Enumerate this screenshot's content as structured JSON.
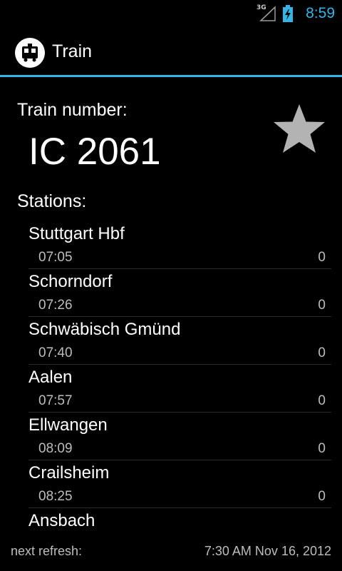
{
  "status_bar": {
    "network": "3G",
    "time": "8:59",
    "accent_color": "#33b5e5"
  },
  "action_bar": {
    "icon": "tram-icon",
    "title": "Train"
  },
  "train": {
    "label": "Train number:",
    "number": "IC 2061",
    "favorite_icon": "star-icon"
  },
  "stations": {
    "label": "Stations:",
    "items": [
      {
        "name": "Stuttgart Hbf",
        "time": "07:05",
        "delay": "0"
      },
      {
        "name": "Schorndorf",
        "time": "07:26",
        "delay": "0"
      },
      {
        "name": "Schwäbisch Gmünd",
        "time": "07:40",
        "delay": "0"
      },
      {
        "name": "Aalen",
        "time": "07:57",
        "delay": "0"
      },
      {
        "name": "Ellwangen",
        "time": "08:09",
        "delay": "0"
      },
      {
        "name": "Crailsheim",
        "time": "08:25",
        "delay": "0"
      },
      {
        "name": "Ansbach",
        "time": "",
        "delay": ""
      }
    ]
  },
  "footer": {
    "label": "next refresh:",
    "value": "7:30 AM Nov 16, 2012"
  }
}
